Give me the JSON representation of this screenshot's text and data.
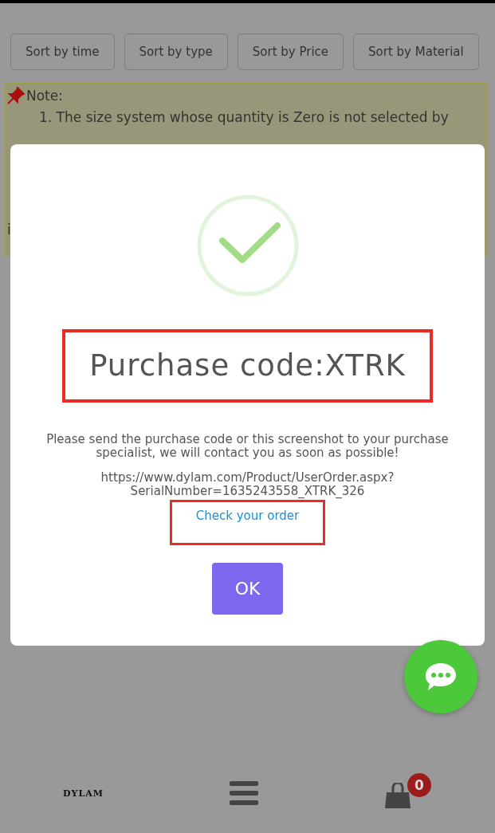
{
  "sort_buttons": [
    "Sort by time",
    "Sort by type",
    "Sort by Price",
    "Sort by Material"
  ],
  "note": {
    "title": "Note:",
    "lines": [
      "1. The size system whose quantity is Zero is not selected by",
      "i"
    ]
  },
  "dialog": {
    "title": "Purchase code:XTRK",
    "message": "Please send the purchase code or this screenshot to your purchase specialist, we will contact you as soon as possible!",
    "url_lines": [
      "https://www.dylam.com/Product/UserOrder.aspx?",
      "SerialNumber=1635243558_XTRK_326"
    ],
    "link": "Check your order",
    "ok_button": "OK"
  },
  "bottom_nav": {
    "logo": "DYLAM",
    "cart_count": "0"
  }
}
